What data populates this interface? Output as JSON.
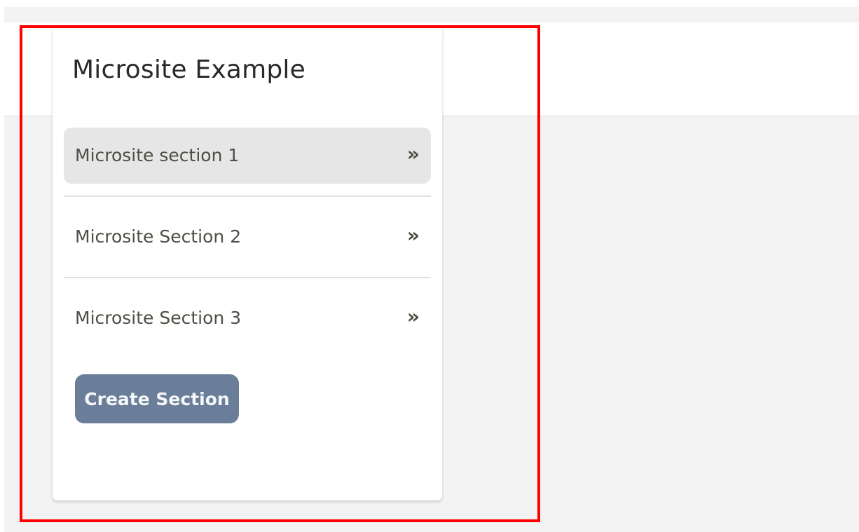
{
  "card": {
    "title": "Microsite Example"
  },
  "sections": [
    {
      "label": "Microsite section 1",
      "arrow": "»",
      "active": true
    },
    {
      "label": "Microsite Section 2",
      "arrow": "»",
      "active": false
    },
    {
      "label": "Microsite Section 3",
      "arrow": "»",
      "active": false
    }
  ],
  "actions": {
    "create_label": "Create Section"
  },
  "colors": {
    "page_background": "#f3f3f3",
    "card_background": "#ffffff",
    "active_item_background": "#e6e6e6",
    "button_background": "#6a7e99",
    "highlight_border": "#ff0000"
  },
  "icons": {
    "section_arrow": "double-chevron-right-icon"
  }
}
